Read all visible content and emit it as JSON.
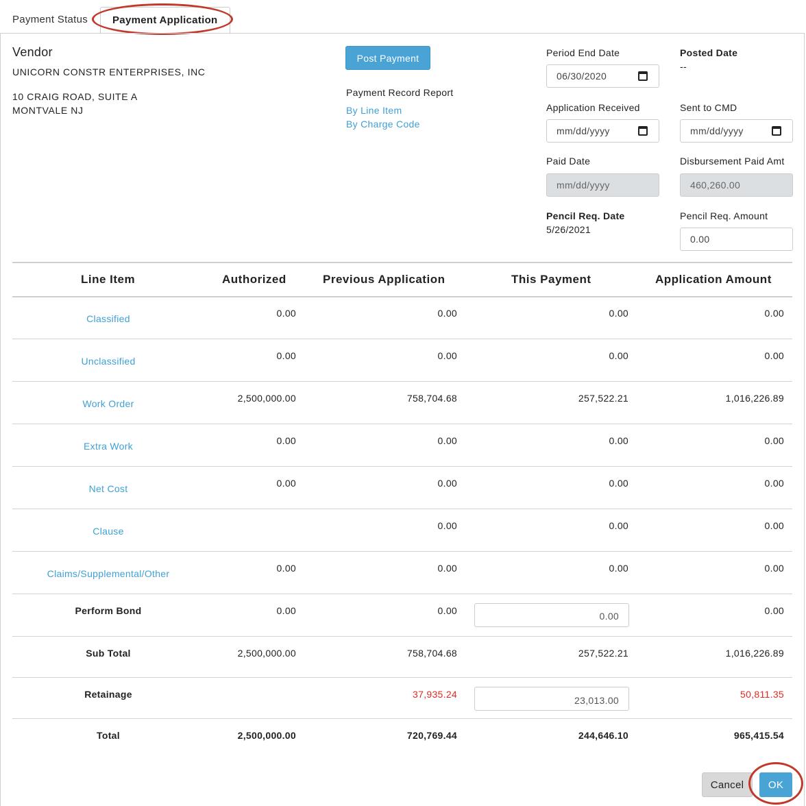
{
  "tabs": [
    {
      "label": "Payment Status"
    },
    {
      "label": "Payment Application"
    }
  ],
  "vendor": {
    "heading": "Vendor",
    "name": "UNICORN CONSTR ENTERPRISES, INC",
    "address_line1": "10 CRAIG ROAD, SUITE A",
    "address_line2": "MONTVALE  NJ"
  },
  "actions": {
    "post_payment": "Post Payment",
    "report_title": "Payment Record Report",
    "report_links": [
      "By Line Item",
      "By Charge Code"
    ]
  },
  "fields": {
    "period_end_date": {
      "label": "Period End Date",
      "value": "06/30/2020"
    },
    "posted_date": {
      "label": "Posted Date",
      "value": "--"
    },
    "application_received": {
      "label": "Application Received",
      "placeholder": "mm/dd/yyyy"
    },
    "sent_to_cmd": {
      "label": "Sent to CMD",
      "placeholder": "mm/dd/yyyy"
    },
    "paid_date": {
      "label": "Paid Date",
      "placeholder": "mm/dd/yyyy"
    },
    "disbursement_paid_amt": {
      "label": "Disbursement Paid Amt",
      "value": "460,260.00"
    },
    "pencil_req_date": {
      "label": "Pencil Req. Date",
      "value": "5/26/2021"
    },
    "pencil_req_amount": {
      "label": "Pencil Req. Amount",
      "value": "0.00"
    }
  },
  "table": {
    "headers": [
      "Line Item",
      "Authorized",
      "Previous Application",
      "This Payment",
      "Application Amount"
    ],
    "rows": [
      {
        "label": "Classified",
        "authorized": "0.00",
        "previous": "0.00",
        "this_payment": "0.00",
        "application": "0.00"
      },
      {
        "label": "Unclassified",
        "authorized": "0.00",
        "previous": "0.00",
        "this_payment": "0.00",
        "application": "0.00"
      },
      {
        "label": "Work Order",
        "authorized": "2,500,000.00",
        "previous": "758,704.68",
        "this_payment": "257,522.21",
        "application": "1,016,226.89"
      },
      {
        "label": "Extra Work",
        "authorized": "0.00",
        "previous": "0.00",
        "this_payment": "0.00",
        "application": "0.00"
      },
      {
        "label": "Net Cost",
        "authorized": "0.00",
        "previous": "0.00",
        "this_payment": "0.00",
        "application": "0.00"
      },
      {
        "label": "Clause",
        "authorized": "",
        "previous": "0.00",
        "this_payment": "0.00",
        "application": "0.00"
      },
      {
        "label": "Claims/Supplemental/Other",
        "authorized": "0.00",
        "previous": "0.00",
        "this_payment": "0.00",
        "application": "0.00"
      }
    ],
    "perform_bond": {
      "label": "Perform Bond",
      "authorized": "0.00",
      "previous": "0.00",
      "this_payment": "0.00",
      "application": "0.00"
    },
    "sub_total": {
      "label": "Sub Total",
      "authorized": "2,500,000.00",
      "previous": "758,704.68",
      "this_payment": "257,522.21",
      "application": "1,016,226.89"
    },
    "retainage": {
      "label": "Retainage",
      "previous": "37,935.24",
      "this_payment": "23,013.00",
      "application": "50,811.35"
    },
    "total": {
      "label": "Total",
      "authorized": "2,500,000.00",
      "previous": "720,769.44",
      "this_payment": "244,646.10",
      "application": "965,415.54"
    }
  },
  "buttons": {
    "cancel": "Cancel",
    "ok": "OK"
  },
  "colors": {
    "accent": "#4aa3d5",
    "link": "#3fa0d4",
    "negative": "#e02a20",
    "annotation": "#c0392b"
  }
}
